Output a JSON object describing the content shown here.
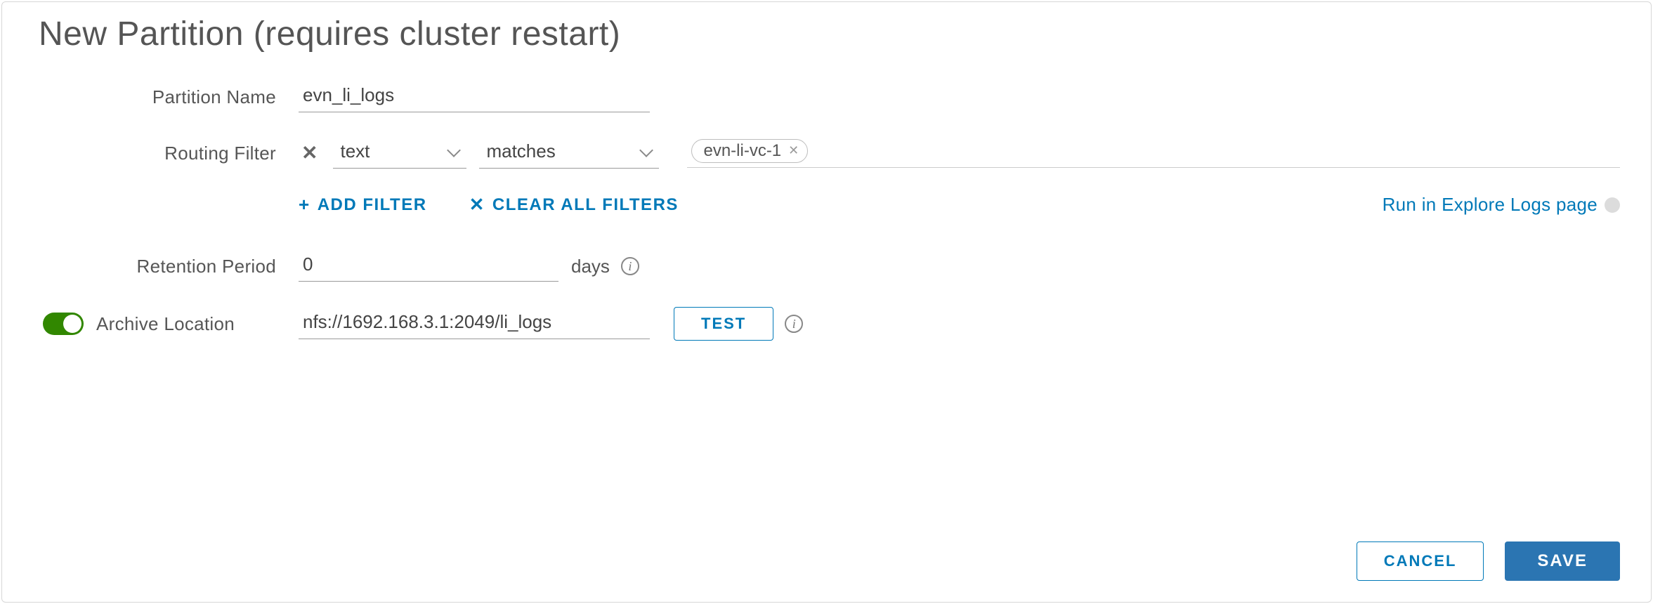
{
  "title": "New Partition (requires cluster restart)",
  "labels": {
    "partition_name": "Partition Name",
    "routing_filter": "Routing Filter",
    "retention_period": "Retention Period",
    "archive_location": "Archive Location"
  },
  "partition_name_value": "evn_li_logs",
  "routing_filter": {
    "field_select": "text",
    "operator_select": "matches",
    "chip_value": "evn-li-vc-1"
  },
  "actions": {
    "add_filter": "ADD FILTER",
    "clear_filters": "CLEAR ALL FILTERS",
    "run_explore": "Run in Explore Logs page"
  },
  "retention": {
    "value": "0",
    "unit": "days"
  },
  "archive": {
    "enabled": true,
    "value": "nfs://1692.168.3.1:2049/li_logs",
    "test_label": "TEST"
  },
  "footer": {
    "cancel": "CANCEL",
    "save": "SAVE"
  }
}
